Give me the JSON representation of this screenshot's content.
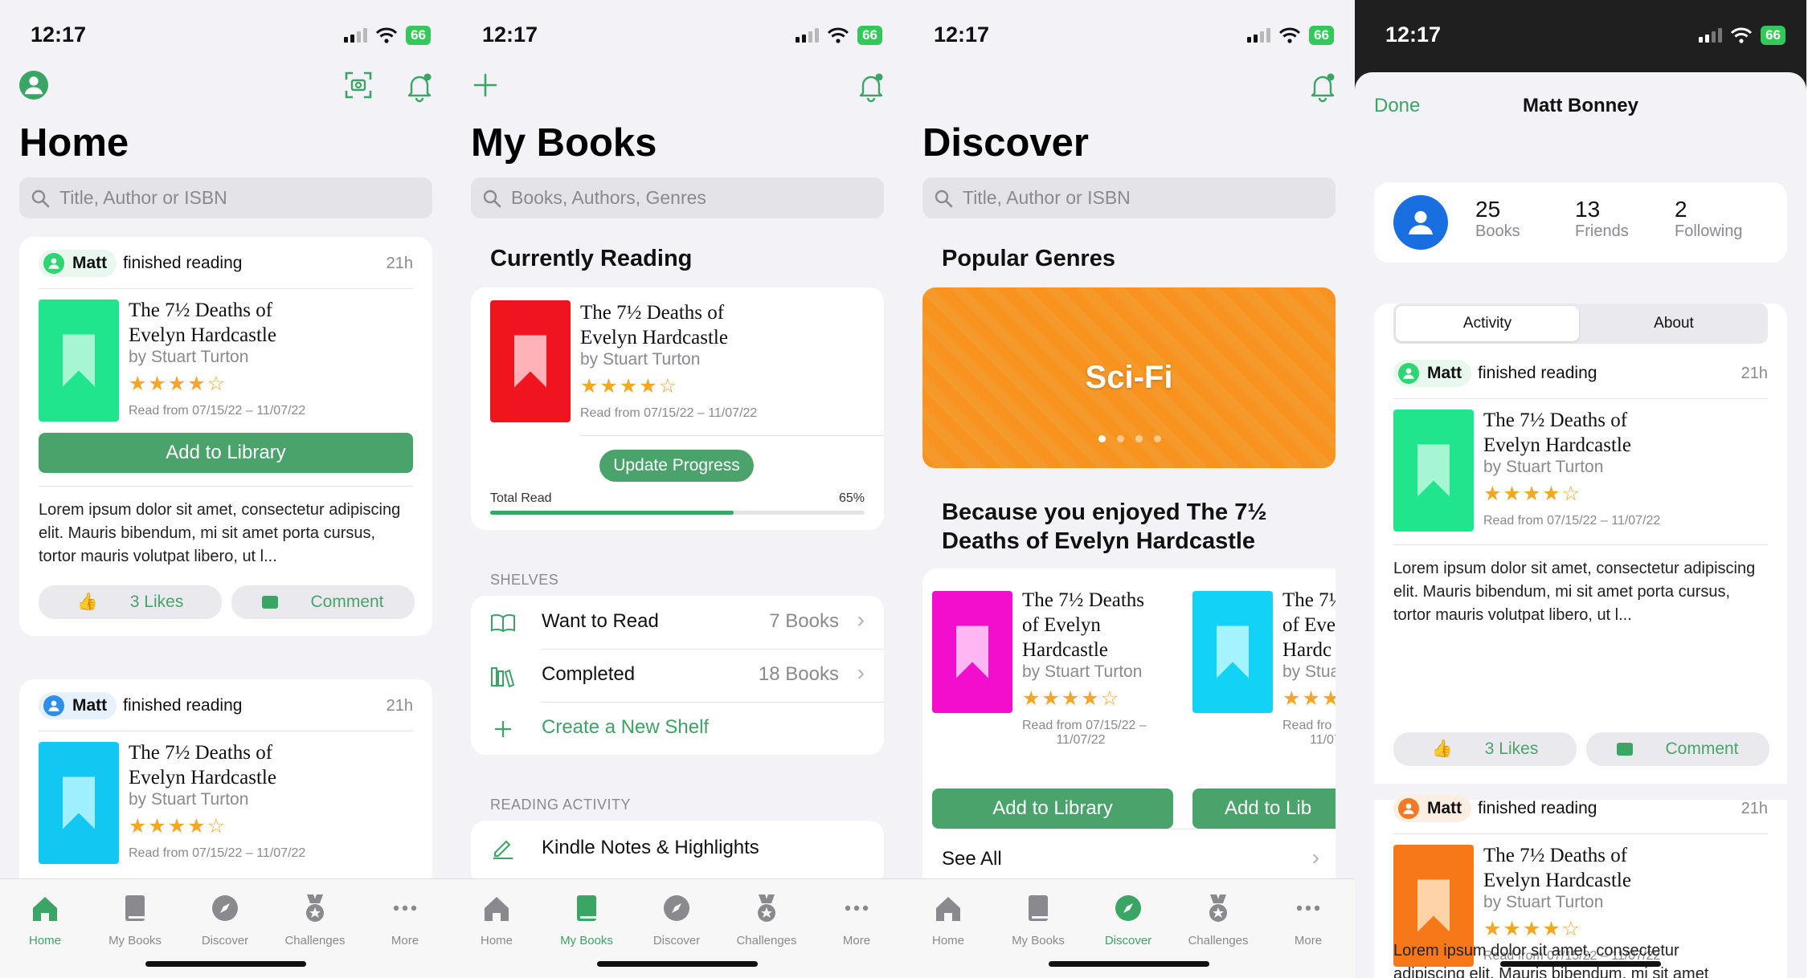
{
  "status": {
    "time": "12:17",
    "battery": "66"
  },
  "tabs": [
    {
      "label": "Home",
      "icon": "house-icon"
    },
    {
      "label": "My Books",
      "icon": "book-icon"
    },
    {
      "label": "Discover",
      "icon": "compass-icon"
    },
    {
      "label": "Challenges",
      "icon": "medal-icon"
    },
    {
      "label": "More",
      "icon": "ellipsis-icon"
    }
  ],
  "book": {
    "title_l1": "The 7½ Deaths of",
    "title_l2": "Evelyn Hardcastle",
    "author": "by Stuart Turton",
    "stars": "★★★★☆",
    "read_from": "Read from 07/15/22 – 11/07/22"
  },
  "home": {
    "title": "Home",
    "search_placeholder": "Title, Author or ISBN",
    "feed": [
      {
        "user": "Matt",
        "action": "finished reading",
        "time": "21h",
        "add_label": "Add to Library",
        "body": "Lorem ipsum dolor sit amet, consectetur adipiscing elit. Mauris bibendum, mi sit amet porta cursus, tortor mauris volutpat libero, ut l...",
        "likes": "3 Likes",
        "comment": "Comment"
      },
      {
        "user": "Matt",
        "action": "finished reading",
        "time": "21h"
      }
    ]
  },
  "mybooks": {
    "title": "My Books",
    "search_placeholder": "Books, Authors, Genres",
    "currently_reading": "Currently Reading",
    "update_progress": "Update Progress",
    "total_read_label": "Total Read",
    "total_read_value": "65%",
    "progress": 0.65,
    "shelves_label": "SHELVES",
    "shelves": [
      {
        "name": "Want to Read",
        "count": "7 Books"
      },
      {
        "name": "Completed",
        "count": "18 Books"
      }
    ],
    "create_shelf": "Create a New Shelf",
    "reading_activity_label": "READING ACTIVITY",
    "kindle": "Kindle Notes & Highlights"
  },
  "discover": {
    "title": "Discover",
    "search_placeholder": "Title, Author or ISBN",
    "popular_genres": "Popular Genres",
    "genre": "Sci-Fi",
    "because_l1": "Because you enjoyed The 7½",
    "because_l2": "Deaths of Evelyn Hardcastle",
    "rec1": {
      "t1": "The 7½ Deaths",
      "t2": "of Evelyn",
      "t3": "Hardcastle",
      "author": "by Stuart Turton",
      "read1": "Read from 07/15/22 –",
      "read2": "11/07/22",
      "btn": "Add to Library"
    },
    "rec2": {
      "t1": "The 7½",
      "t2": "of Eve",
      "t3": "Hardc",
      "author": "by Stua",
      "read1": "Read fro",
      "read2": "11/07/2",
      "btn": "Add to Lib"
    },
    "see_all": "See All"
  },
  "profile": {
    "done": "Done",
    "name": "Matt Bonney",
    "stats": [
      {
        "value": "25",
        "label": "Books"
      },
      {
        "value": "13",
        "label": "Friends"
      },
      {
        "value": "2",
        "label": "Following"
      }
    ],
    "seg": [
      "Activity",
      "About"
    ],
    "feed": [
      {
        "user": "Matt",
        "action": "finished reading",
        "time": "21h",
        "body": "Lorem ipsum dolor sit amet, consectetur adipiscing elit. Mauris bibendum, mi sit amet porta cursus, tortor mauris volutpat libero, ut l...",
        "likes": "3 Likes",
        "comment": "Comment"
      },
      {
        "user": "Matt",
        "action": "finished reading",
        "time": "21h",
        "body_l1": "Lorem ipsum dolor sit amet, consectetur",
        "body_l2": "adipiscing elit. Mauris bibendum, mi sit amet"
      }
    ]
  },
  "colors": {
    "accent": "#4aa36b",
    "star": "#f5a623"
  }
}
